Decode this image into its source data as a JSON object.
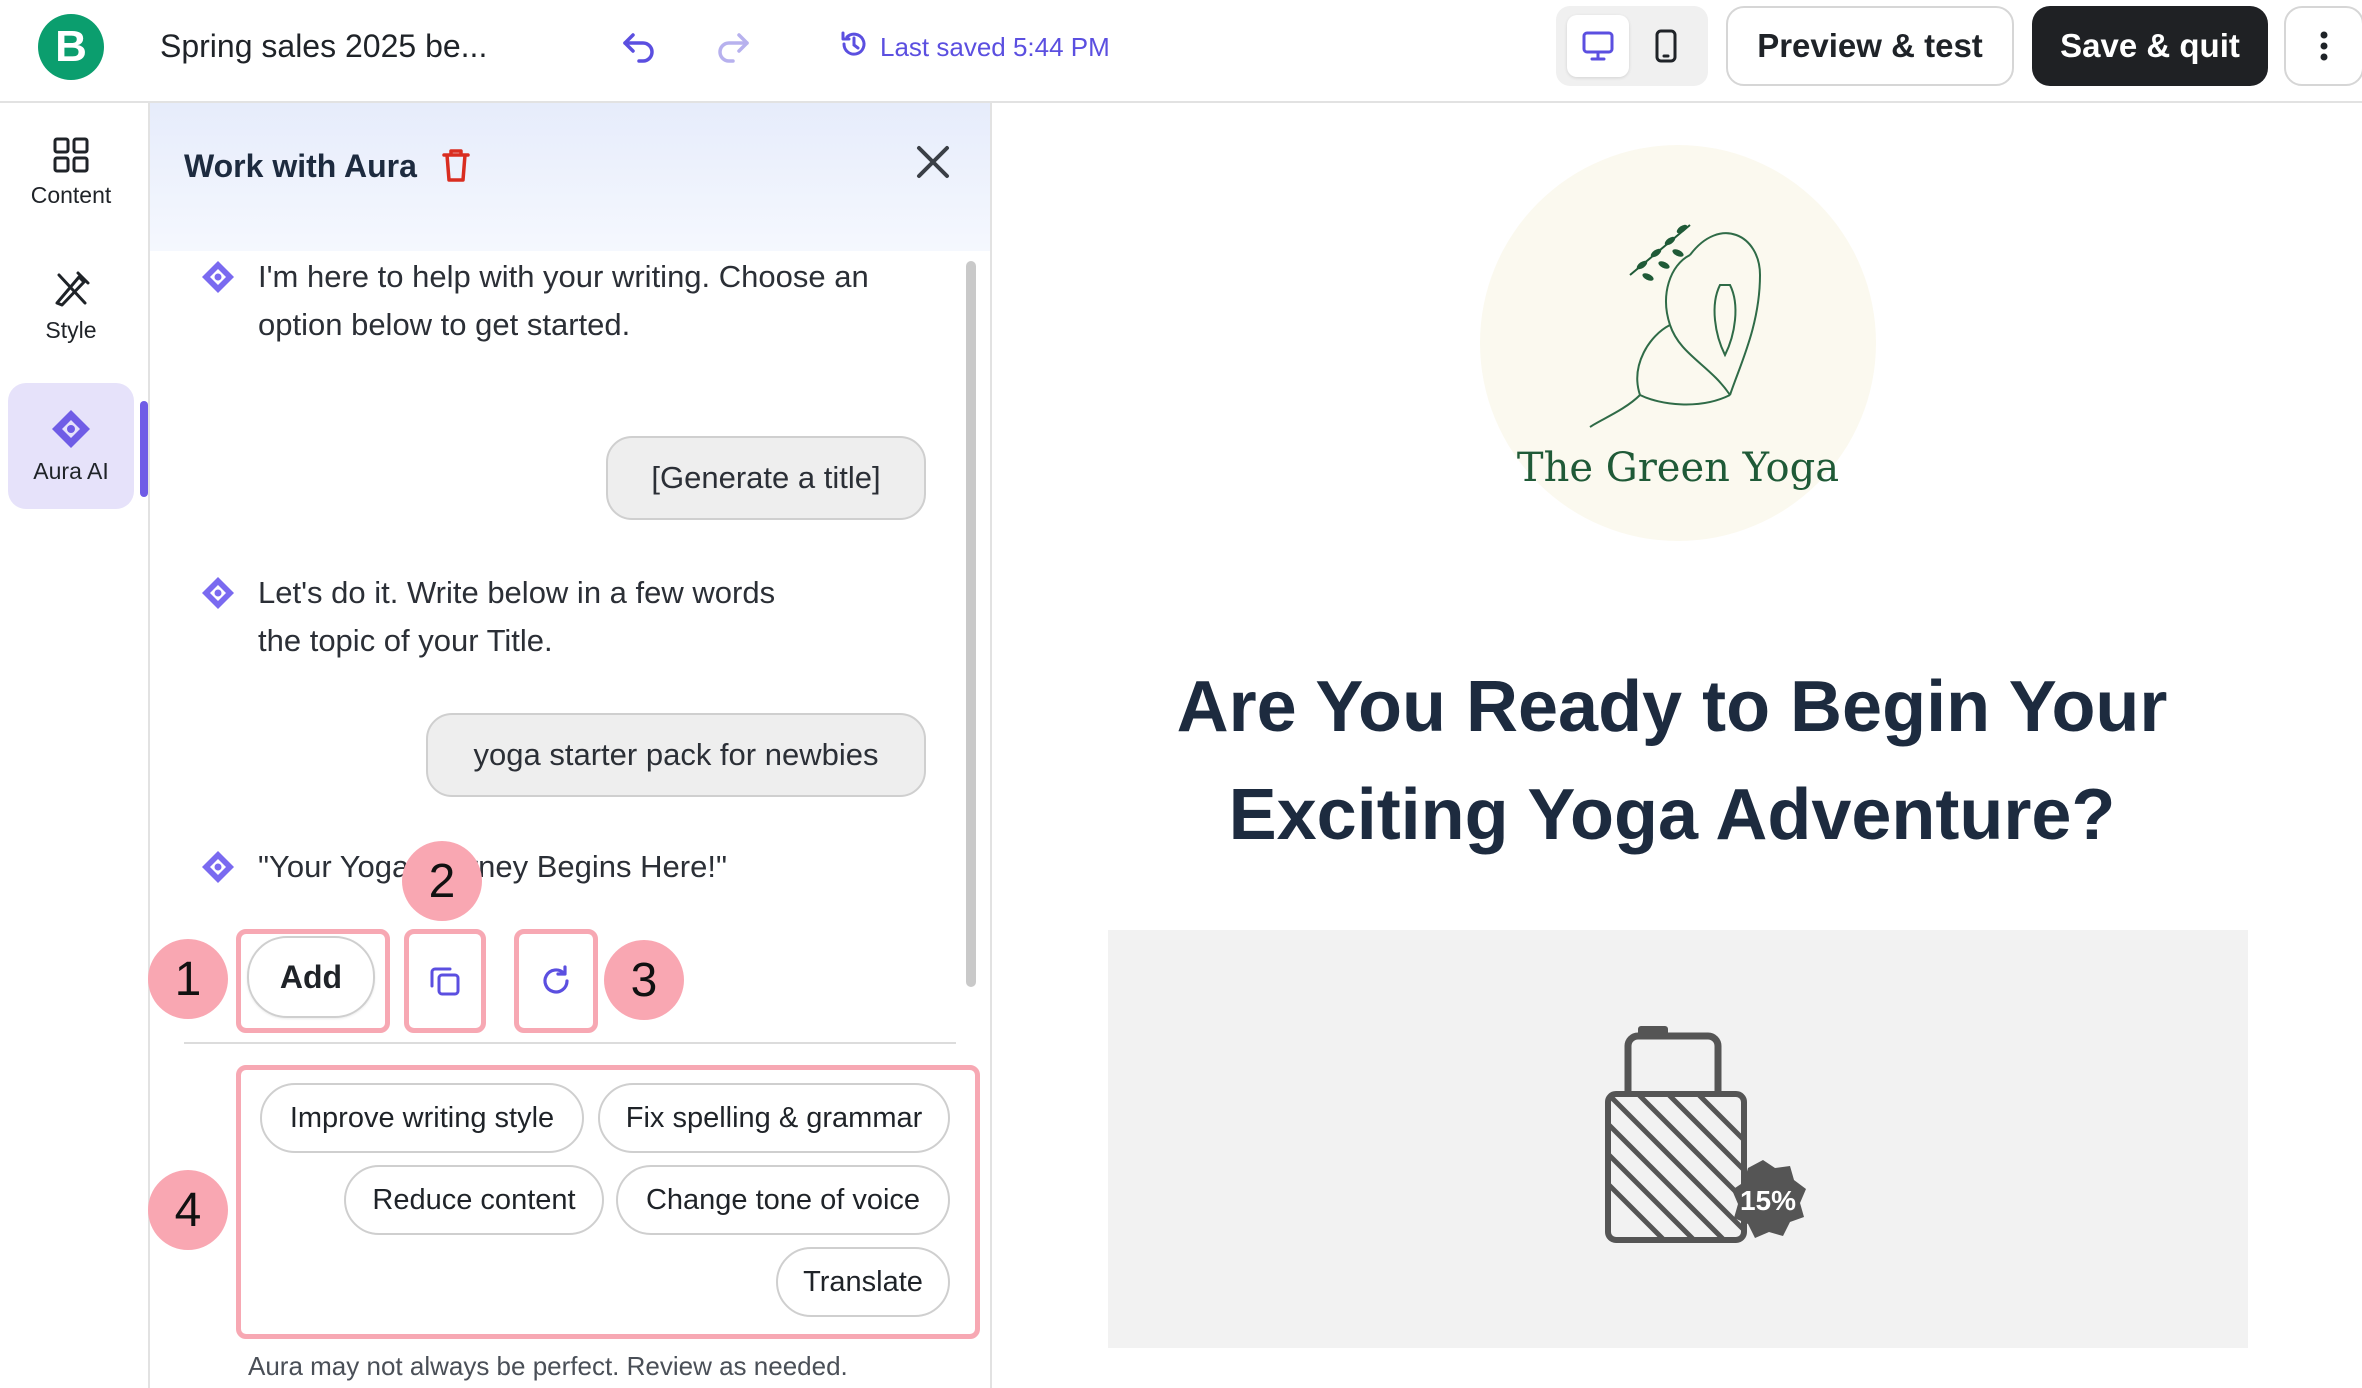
{
  "topbar": {
    "logo_letter": "B",
    "document_title": "Spring sales 2025 be...",
    "last_saved": "Last saved 5:44 PM",
    "preview_label": "Preview & test",
    "save_label": "Save & quit",
    "accent_color": "#5b4fe0"
  },
  "rail": {
    "items": [
      {
        "label": "Content",
        "icon": "grid-icon"
      },
      {
        "label": "Style",
        "icon": "brush-icon"
      },
      {
        "label": "Aura AI",
        "icon": "sparkle-icon",
        "active": true
      }
    ]
  },
  "panel": {
    "title": "Work with Aura",
    "messages": [
      {
        "from": "assistant",
        "lines": [
          "I'm here to help with your writing. Choose an",
          "option below to get started."
        ]
      },
      {
        "from": "user",
        "text": "[Generate a title]"
      },
      {
        "from": "assistant",
        "lines": [
          "Let's do it. Write below in a few words",
          "the topic of your Title."
        ]
      },
      {
        "from": "user",
        "text": "yoga starter pack for newbies"
      },
      {
        "from": "assistant",
        "lines": [
          "\"Your Yoga Journey Begins Here!\""
        ]
      }
    ],
    "actions": {
      "add_label": "Add"
    },
    "chips": [
      "Improve writing style",
      "Fix spelling & grammar",
      "Reduce content",
      "Change tone of voice",
      "Translate"
    ],
    "disclaimer": "Aura may not always be perfect. Review as needed.",
    "callouts": [
      "1",
      "2",
      "3",
      "4"
    ]
  },
  "preview": {
    "brand_name": "The Green Yoga",
    "headline_lines": [
      "Are You Ready to Begin Your",
      "Exciting Yoga Adventure?"
    ],
    "discount_badge": "15%"
  }
}
